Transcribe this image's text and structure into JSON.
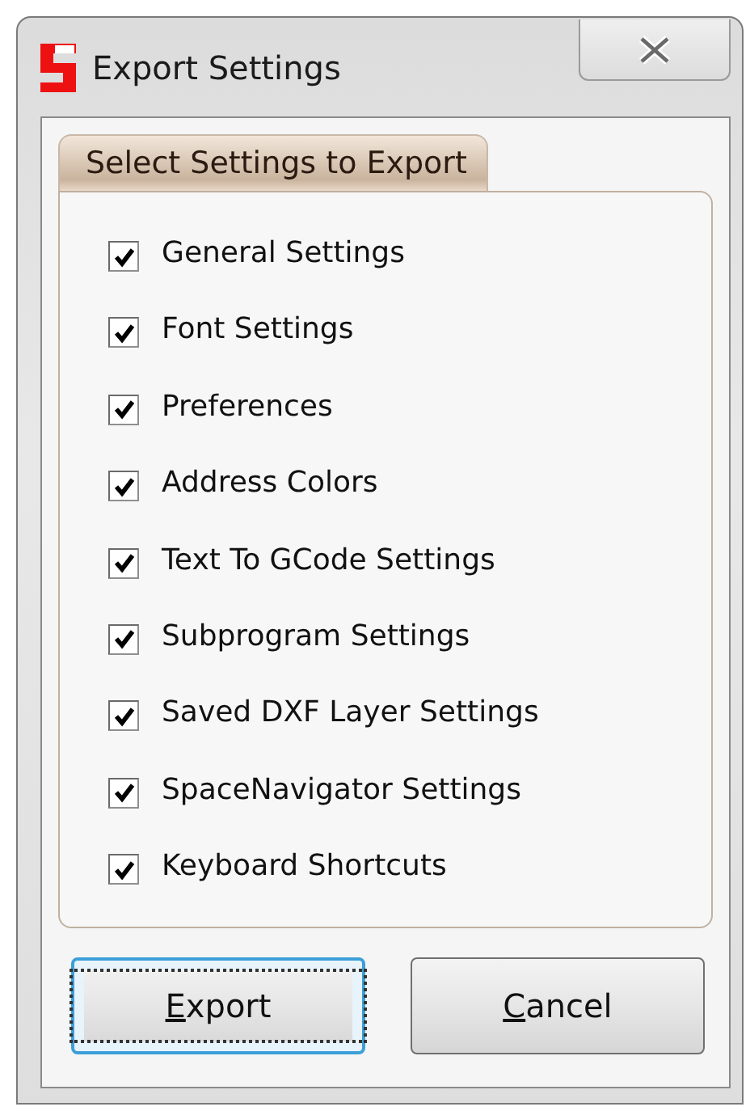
{
  "window": {
    "title": "Export Settings"
  },
  "tab": {
    "label": "Select Settings to Export",
    "selected": true
  },
  "options": [
    {
      "label": "General Settings",
      "checked": true
    },
    {
      "label": "Font Settings",
      "checked": true
    },
    {
      "label": "Preferences",
      "checked": true
    },
    {
      "label": "Address Colors",
      "checked": true
    },
    {
      "label": "Text To GCode Settings",
      "checked": true
    },
    {
      "label": "Subprogram Settings",
      "checked": true
    },
    {
      "label": "Saved DXF Layer Settings",
      "checked": true
    },
    {
      "label": "SpaceNavigator Settings",
      "checked": true
    },
    {
      "label": "Keyboard Shortcuts",
      "checked": true
    }
  ],
  "buttons": [
    {
      "label": "Export",
      "focused": true
    },
    {
      "label": "Cancel",
      "focused": false
    }
  ]
}
